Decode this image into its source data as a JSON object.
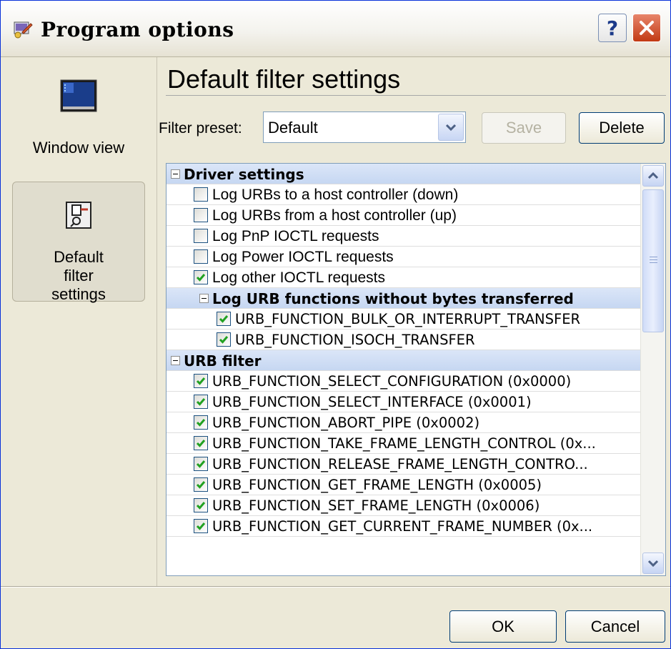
{
  "window": {
    "title": "Program options",
    "help_label": "?",
    "icons": {
      "app": "program-options-icon",
      "close": "close-icon"
    }
  },
  "sidebar": {
    "items": [
      {
        "label": "Window view",
        "icon": "window-view-icon",
        "selected": false
      },
      {
        "label": "Default filter settings",
        "icon": "filter-settings-icon",
        "selected": true
      }
    ]
  },
  "main": {
    "title": "Default filter settings",
    "preset": {
      "label": "Filter preset:",
      "value": "Default",
      "save_label": "Save",
      "delete_label": "Delete"
    },
    "tree": {
      "rows": [
        {
          "kind": "group",
          "text": "Driver settings"
        },
        {
          "kind": "item",
          "text": "Log URBs to a host controller (down)",
          "checked": false
        },
        {
          "kind": "item",
          "text": "Log URBs from a host controller (up)",
          "checked": false
        },
        {
          "kind": "item",
          "text": "Log PnP IOCTL requests",
          "checked": false
        },
        {
          "kind": "item",
          "text": "Log Power IOCTL requests",
          "checked": false
        },
        {
          "kind": "item",
          "text": "Log other IOCTL requests",
          "checked": true
        },
        {
          "kind": "sub",
          "text": "Log URB functions without bytes transferred"
        },
        {
          "kind": "subitem",
          "text": "URB_FUNCTION_BULK_OR_INTERRUPT_TRANSFER",
          "checked": true
        },
        {
          "kind": "subitem",
          "text": "URB_FUNCTION_ISOCH_TRANSFER",
          "checked": true
        },
        {
          "kind": "group",
          "text": "URB filter"
        },
        {
          "kind": "urb",
          "text": "URB_FUNCTION_SELECT_CONFIGURATION (0x0000)",
          "checked": true
        },
        {
          "kind": "urb",
          "text": "URB_FUNCTION_SELECT_INTERFACE (0x0001)",
          "checked": true
        },
        {
          "kind": "urb",
          "text": "URB_FUNCTION_ABORT_PIPE (0x0002)",
          "checked": true
        },
        {
          "kind": "urb",
          "text": "URB_FUNCTION_TAKE_FRAME_LENGTH_CONTROL (0x...",
          "checked": true
        },
        {
          "kind": "urb",
          "text": "URB_FUNCTION_RELEASE_FRAME_LENGTH_CONTRO...",
          "checked": true
        },
        {
          "kind": "urb",
          "text": "URB_FUNCTION_GET_FRAME_LENGTH (0x0005)",
          "checked": true
        },
        {
          "kind": "urb",
          "text": "URB_FUNCTION_SET_FRAME_LENGTH (0x0006)",
          "checked": true
        },
        {
          "kind": "urb",
          "text": "URB_FUNCTION_GET_CURRENT_FRAME_NUMBER (0x...",
          "checked": true
        }
      ]
    }
  },
  "footer": {
    "ok_label": "OK",
    "cancel_label": "Cancel"
  },
  "colors": {
    "check": "#21a121",
    "group_bg": "#c6d7f2",
    "title_border": "#0831d9",
    "close": "#c23a14"
  }
}
